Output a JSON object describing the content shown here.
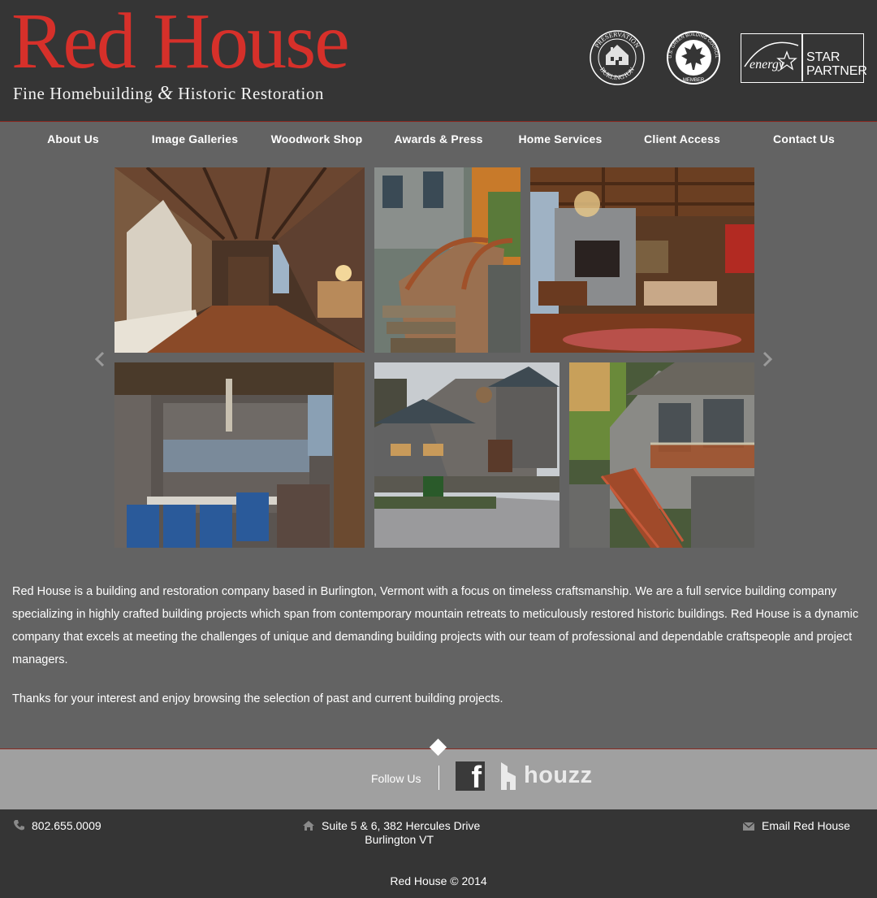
{
  "brand": {
    "name": "Red House",
    "tagline_part1": "Fine Homebuilding",
    "tagline_amp": "&",
    "tagline_part2": "Historic Restoration"
  },
  "badges": {
    "preservation": "PRESERVATION BURLINGTON",
    "usgbc": "U.S. GREEN BUILDING COUNCIL MEMBER",
    "energy_star_script": "energy",
    "energy_star_line1": "STAR",
    "energy_star_line2": "PARTNER"
  },
  "nav": [
    "About Us",
    "Image Galleries",
    "Woodwork Shop",
    "Awards & Press",
    "Home Services",
    "Client Access",
    "Contact Us"
  ],
  "gallery": {
    "photos": [
      "interior-hallway-photo",
      "curved-stair-photo",
      "great-room-photo",
      "kitchen-photo",
      "stone-house-exterior-photo",
      "deck-stair-exterior-photo"
    ]
  },
  "content": {
    "paragraph1": "Red House is a building and restoration company based in Burlington, Vermont with a focus on timeless craftsmanship. We are a full service building company specializing in highly crafted building projects which span from contemporary mountain retreats to meticulously restored historic buildings. Red House is a dynamic company that excels at meeting the challenges of unique and demanding building projects with our team of professional and dependable craftspeople and project managers.",
    "paragraph2": "Thanks for your interest and enjoy browsing the selection of past and current building projects."
  },
  "follow": {
    "label": "Follow Us",
    "facebook": "f",
    "houzz": "houzz"
  },
  "footer": {
    "phone": "802.655.0009",
    "address_line1": "Suite 5 & 6, 382 Hercules Drive",
    "address_line2": "Burlington VT",
    "email": "Email Red House",
    "copyright": "Red House © 2014"
  },
  "colors": {
    "brand_red": "#d6302a",
    "header_bg": "#353535",
    "body_bg": "#636363",
    "follow_bg": "#a0a0a0"
  }
}
